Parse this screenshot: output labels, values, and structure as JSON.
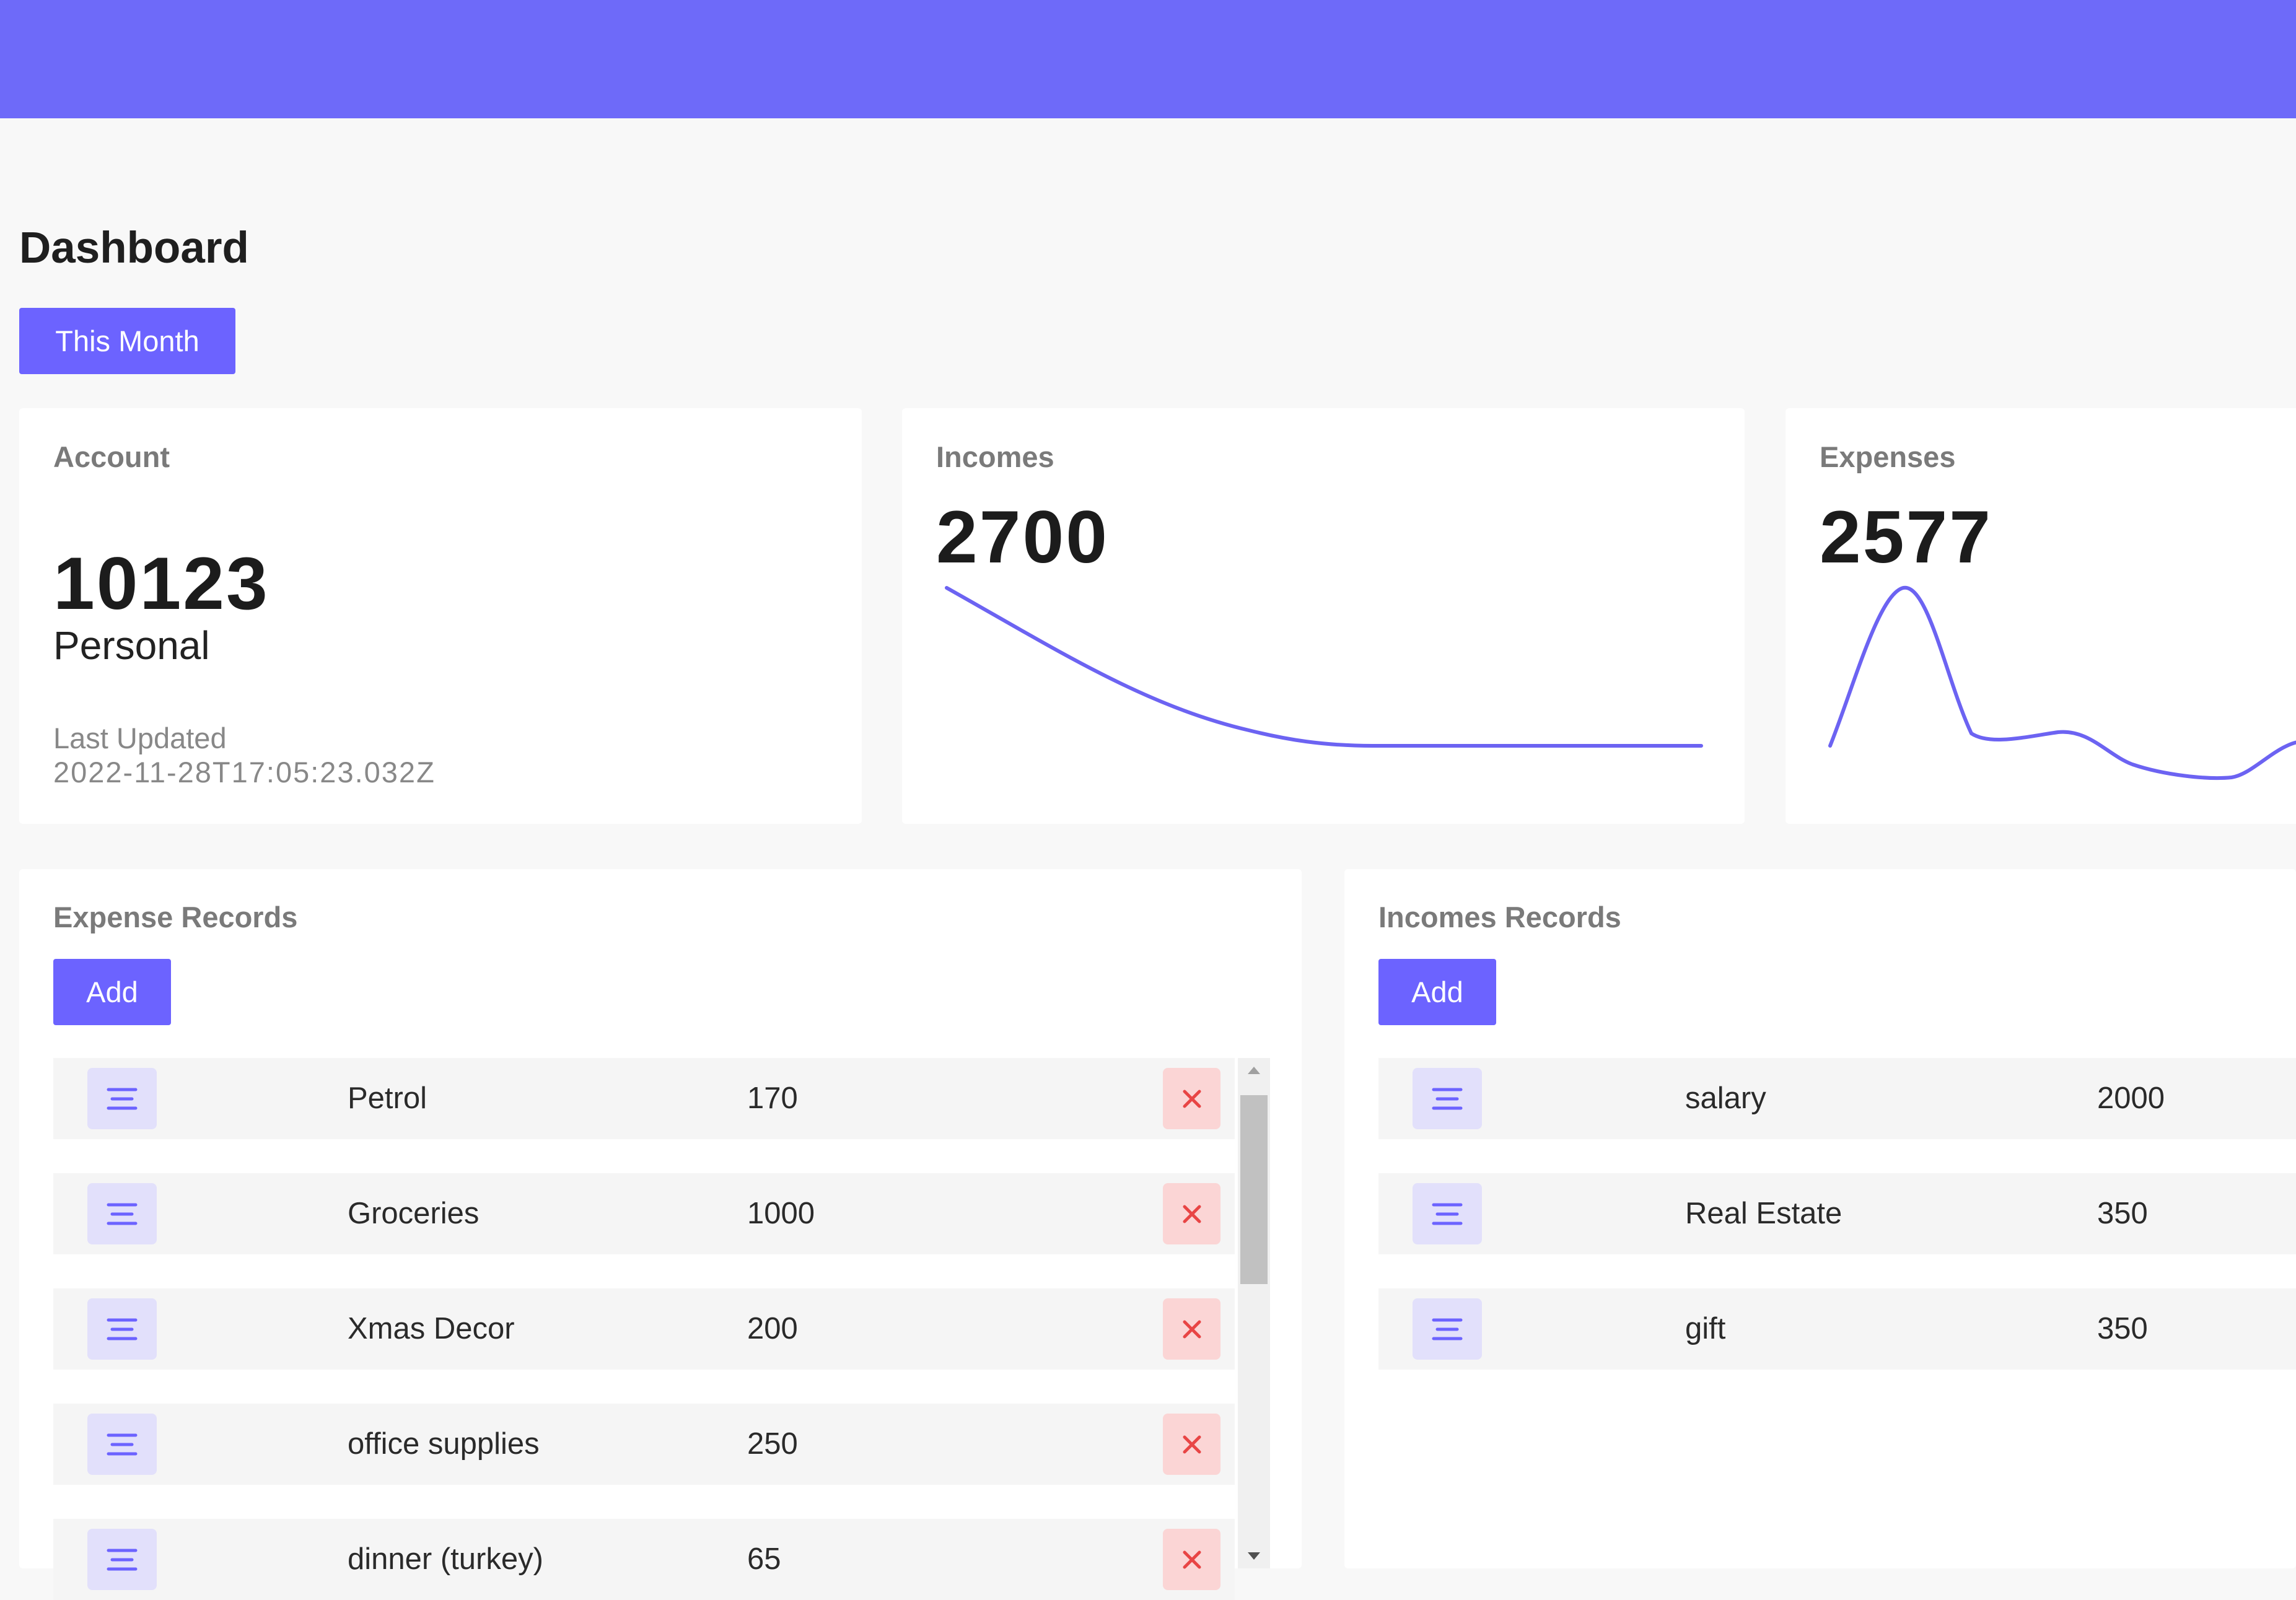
{
  "header": {
    "title": "Dashboard",
    "period_button": "This Month"
  },
  "colors": {
    "accent": "#6c63ff",
    "topbar": "#6e6af9",
    "delete_bg": "#fbd5d5",
    "delete_icon": "#e84545"
  },
  "account": {
    "label": "Account",
    "balance": "10123",
    "type": "Personal",
    "updated_label": "Last Updated",
    "updated_value": "2022-11-28T17:05:23.032Z"
  },
  "incomes": {
    "label": "Incomes",
    "total": "2700"
  },
  "expenses": {
    "label": "Expenses",
    "total": "2577"
  },
  "expense_records": {
    "title": "Expense Records",
    "add_label": "Add",
    "items": [
      {
        "name": "Petrol",
        "amount": "170"
      },
      {
        "name": "Groceries",
        "amount": "1000"
      },
      {
        "name": "Xmas Decor",
        "amount": "200"
      },
      {
        "name": "office supplies",
        "amount": "250"
      },
      {
        "name": "dinner (turkey)",
        "amount": "65"
      }
    ]
  },
  "income_records": {
    "title": "Incomes Records",
    "add_label": "Add",
    "items": [
      {
        "name": "salary",
        "amount": "2000"
      },
      {
        "name": "Real Estate",
        "amount": "350"
      },
      {
        "name": "gift",
        "amount": "350"
      }
    ]
  },
  "icons": {
    "row_menu": "menu-lines-icon",
    "row_delete": "close-icon",
    "scroll_up": "arrow-up-icon",
    "scroll_down": "arrow-down-icon"
  }
}
